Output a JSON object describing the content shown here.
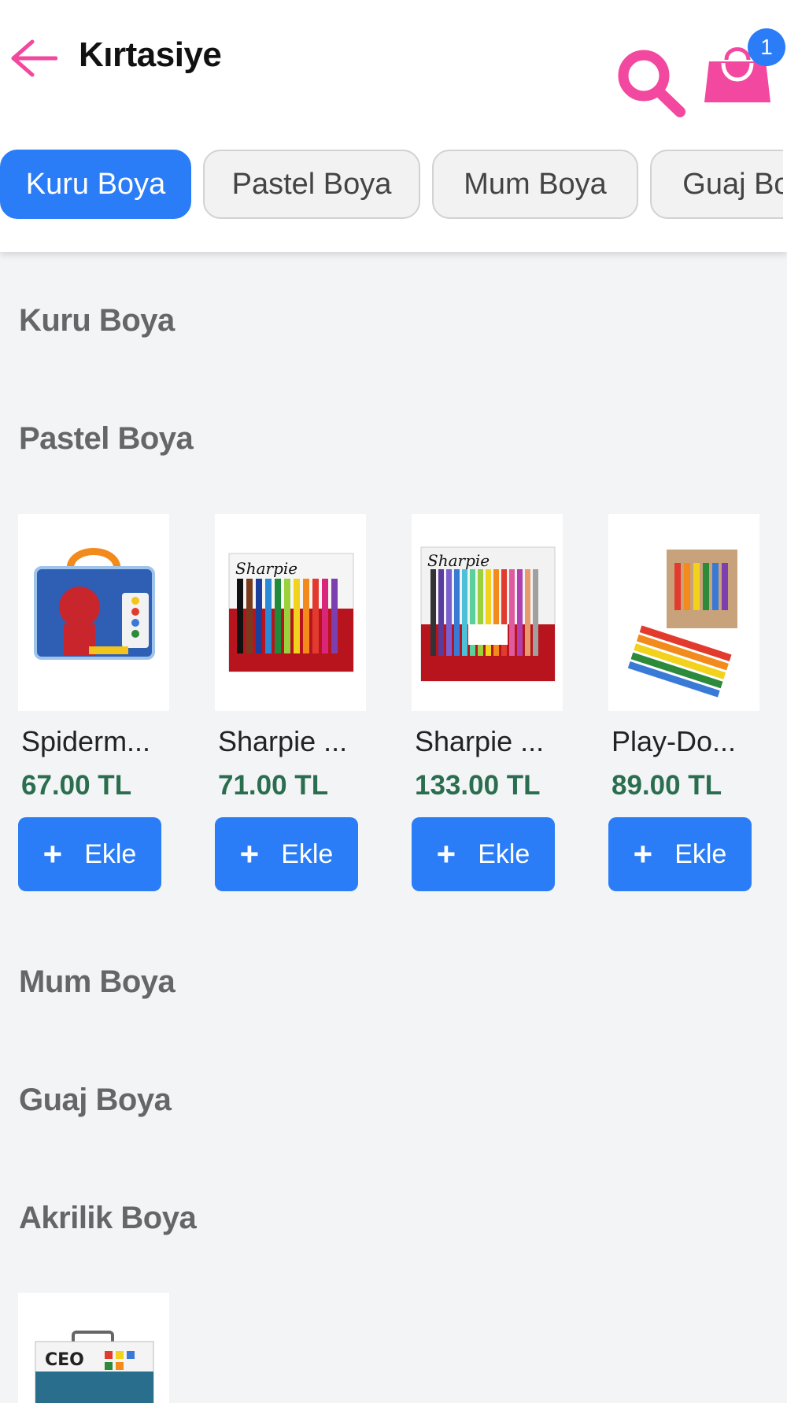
{
  "header": {
    "title": "Kırtasiye",
    "cart_count": "1"
  },
  "tabs": [
    {
      "label": "Kuru Boya",
      "active": true
    },
    {
      "label": "Pastel Boya",
      "active": false
    },
    {
      "label": "Mum Boya",
      "active": false
    },
    {
      "label": "Guaj Boya",
      "active": false
    }
  ],
  "sections": [
    {
      "title": "Kuru Boya"
    },
    {
      "title": "Pastel Boya"
    },
    {
      "title": "Mum Boya"
    },
    {
      "title": "Guaj Boya"
    },
    {
      "title": "Akrilik Boya"
    }
  ],
  "pastel_products": [
    {
      "name": "Spiderm...",
      "price": "67.00 TL",
      "add_label": "Ekle"
    },
    {
      "name": "Sharpie ...",
      "price": "71.00 TL",
      "add_label": "Ekle"
    },
    {
      "name": "Sharpie ...",
      "price": "133.00 TL",
      "add_label": "Ekle"
    },
    {
      "name": "Play-Do...",
      "price": "89.00 TL",
      "add_label": "Ekle"
    }
  ],
  "colors": {
    "accent_pink": "#f2489f",
    "primary_blue": "#2a7cf7",
    "price_green": "#2a6e4f"
  }
}
